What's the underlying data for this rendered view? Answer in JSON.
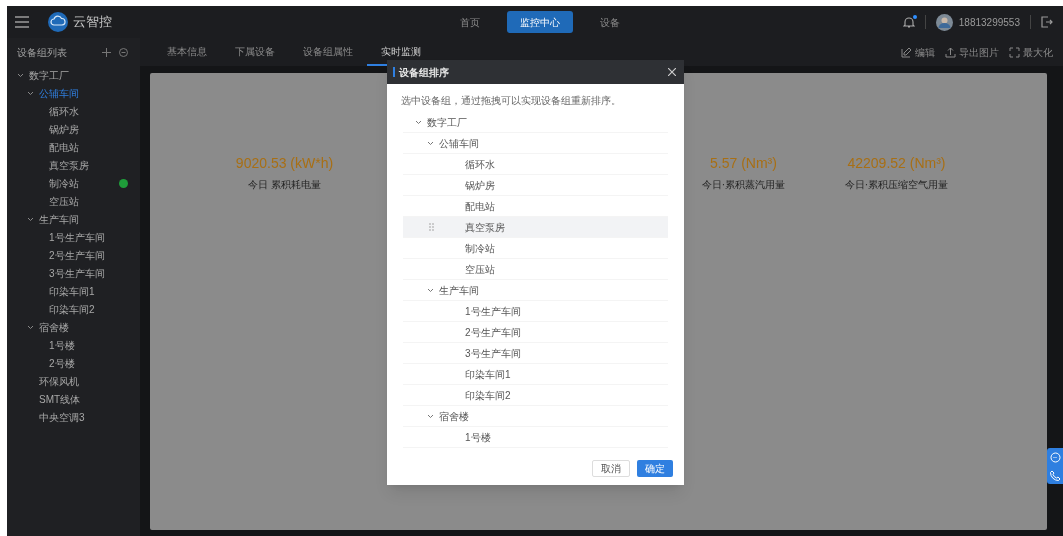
{
  "header": {
    "app_name": "云智控",
    "nav": [
      {
        "label": "首页",
        "selected": false
      },
      {
        "label": "监控中心",
        "selected": true
      },
      {
        "label": "设备",
        "selected": false
      }
    ],
    "notifications_unread": true,
    "user_phone": "18813299553"
  },
  "sidebar": {
    "title": "设备组列表",
    "tree": [
      {
        "label": "数字工厂",
        "selected": false,
        "expanded": true,
        "children": [
          {
            "label": "公辅车间",
            "selected": true,
            "expanded": true,
            "children": [
              {
                "label": "循环水",
                "selected": false
              },
              {
                "label": "锅炉房",
                "selected": false
              },
              {
                "label": "配电站",
                "selected": false
              },
              {
                "label": "真空泵房",
                "selected": false
              },
              {
                "label": "制冷站",
                "selected": false,
                "color": "#1f9d3a"
              },
              {
                "label": "空压站",
                "selected": false
              }
            ]
          },
          {
            "label": "生产车间",
            "selected": false,
            "expanded": true,
            "children": [
              {
                "label": "1号生产车间",
                "selected": false
              },
              {
                "label": "2号生产车间",
                "selected": false
              },
              {
                "label": "3号生产车间",
                "selected": false
              },
              {
                "label": "印染车间1",
                "selected": false
              },
              {
                "label": "印染车间2",
                "selected": false
              }
            ]
          },
          {
            "label": "宿舍楼",
            "selected": false,
            "expanded": true,
            "children": [
              {
                "label": "1号楼",
                "selected": false
              },
              {
                "label": "2号楼",
                "selected": false
              }
            ]
          },
          {
            "label": "环保风机",
            "selected": false
          },
          {
            "label": "SMT线体",
            "selected": false
          },
          {
            "label": "中央空调3",
            "selected": false
          }
        ]
      }
    ]
  },
  "tabs": [
    {
      "label": "基本信息",
      "selected": false
    },
    {
      "label": "下属设备",
      "selected": false
    },
    {
      "label": "设备组属性",
      "selected": false
    },
    {
      "label": "实时监测",
      "selected": true
    }
  ],
  "toolbar": [
    {
      "kind": "edit",
      "label": "编辑"
    },
    {
      "kind": "export",
      "label": "导出图片"
    },
    {
      "kind": "maximize",
      "label": "最大化"
    }
  ],
  "stats": [
    {
      "value": "9020.53 (kW*h)",
      "label": "今日 累积耗电量"
    },
    {
      "value": "5.57 (Nm³)",
      "label": "今日·累积蒸汽用量"
    },
    {
      "value": "42209.52 (Nm³)",
      "label": "今日·累积压缩空气用量"
    }
  ],
  "dialog": {
    "title": "设备组排序",
    "description": "选中设备组，通过拖拽可以实现设备组重新排序。",
    "tree": [
      {
        "label": "数字工厂",
        "hovered": false,
        "children": [
          {
            "label": "公辅车间",
            "hovered": false,
            "children": [
              {
                "label": "循环水",
                "hovered": false
              },
              {
                "label": "锅炉房",
                "hovered": false
              },
              {
                "label": "配电站",
                "hovered": false
              },
              {
                "label": "真空泵房",
                "hovered": true
              },
              {
                "label": "制冷站",
                "hovered": false
              },
              {
                "label": "空压站",
                "hovered": false
              }
            ]
          },
          {
            "label": "生产车间",
            "hovered": false,
            "children": [
              {
                "label": "1号生产车间",
                "hovered": false
              },
              {
                "label": "2号生产车间",
                "hovered": false
              },
              {
                "label": "3号生产车间",
                "hovered": false
              },
              {
                "label": "印染车间1",
                "hovered": false
              },
              {
                "label": "印染车间2",
                "hovered": false
              }
            ]
          },
          {
            "label": "宿舍楼",
            "hovered": false,
            "children": [
              {
                "label": "1号楼",
                "hovered": false
              }
            ]
          }
        ]
      }
    ],
    "cancel": "取消",
    "ok": "确定"
  }
}
